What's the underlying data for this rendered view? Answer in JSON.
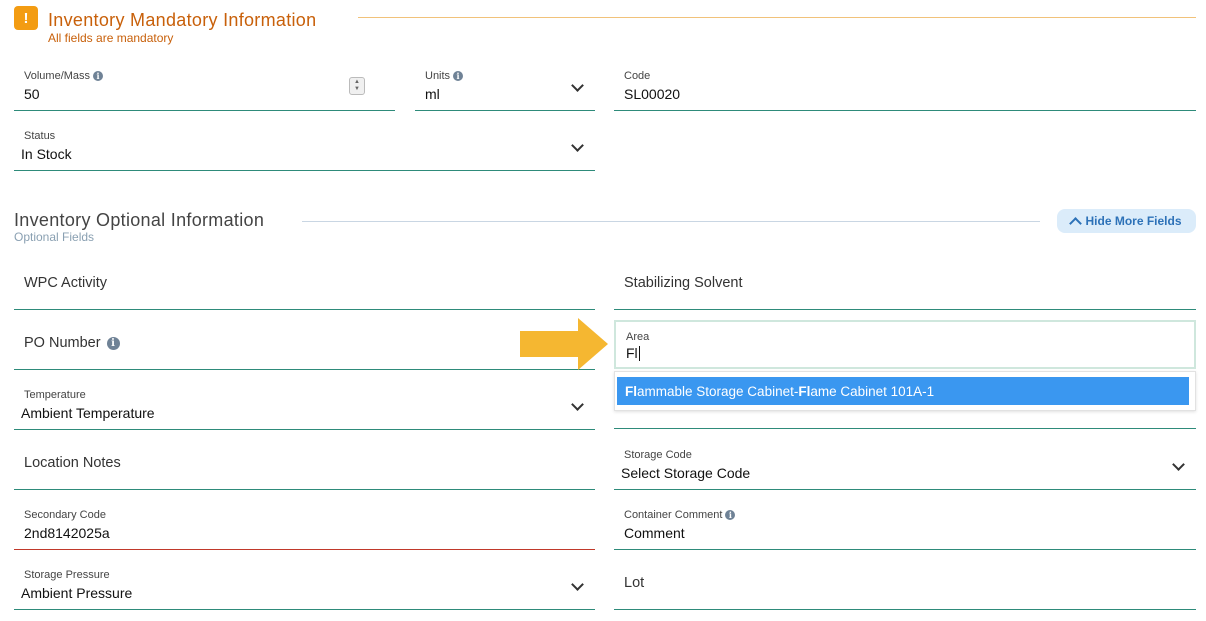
{
  "mandatory": {
    "title": "Inventory Mandatory Information",
    "subtitle": "All fields are mandatory",
    "badge": "!",
    "volume": {
      "label": "Volume/Mass",
      "value": "50"
    },
    "units": {
      "label": "Units",
      "value": "ml"
    },
    "code": {
      "label": "Code",
      "value": "SL00020"
    },
    "status": {
      "label": "Status",
      "value": "In Stock"
    }
  },
  "optional": {
    "title": "Inventory Optional Information",
    "subtitle": "Optional Fields",
    "hide_button": "Hide More Fields",
    "wpc_activity": {
      "label": "WPC Activity"
    },
    "stabilizing_solvent": {
      "label": "Stabilizing Solvent"
    },
    "po_number": {
      "label": "PO Number"
    },
    "area": {
      "label": "Area",
      "value": "Fl",
      "option": {
        "part1_bold": "Fl",
        "part2": "ammable Storage Cabinet-",
        "part3_bold": "Fl",
        "part4": "ame Cabinet 101A-1"
      }
    },
    "temperature": {
      "label": "Temperature",
      "value": "Ambient Temperature"
    },
    "location_notes": {
      "label": "Location Notes"
    },
    "storage_code": {
      "label": "Storage Code",
      "value": "Select Storage Code"
    },
    "secondary_code": {
      "label": "Secondary Code",
      "value": "2nd8142025a"
    },
    "container_comment": {
      "label": "Container Comment",
      "value": "Comment"
    },
    "storage_pressure": {
      "label": "Storage Pressure",
      "value": "Ambient Pressure"
    },
    "lot": {
      "label": "Lot"
    }
  },
  "colors": {
    "warning": "#f39c12",
    "accent_orange": "#c8600a",
    "field_line": "#2e8b7a",
    "error_line": "#c0392b",
    "highlight": "#3a97f0",
    "arrow": "#f5b731"
  },
  "icons": [
    "warning-icon",
    "info-icon",
    "chevron-down-icon",
    "chevron-up-icon",
    "spinner-icon",
    "arrow-right-icon"
  ]
}
